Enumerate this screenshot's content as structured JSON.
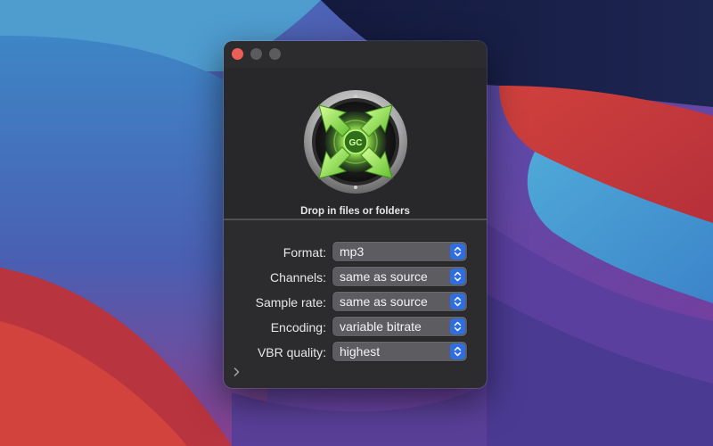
{
  "window": {
    "title": "",
    "traffic_lights": [
      "close",
      "minimize",
      "zoom"
    ]
  },
  "drop_zone": {
    "icon": "audio-converter-app-icon",
    "label": "Drop in files or folders"
  },
  "settings": {
    "format": {
      "label": "Format:",
      "value": "mp3"
    },
    "channels": {
      "label": "Channels:",
      "value": "same as source"
    },
    "sample_rate": {
      "label": "Sample rate:",
      "value": "same as source"
    },
    "encoding": {
      "label": "Encoding:",
      "value": "variable bitrate"
    },
    "vbr_quality": {
      "label": "VBR quality:",
      "value": "highest"
    }
  },
  "disclosure": {
    "icon": "chevron-right-icon"
  },
  "colors": {
    "window_bg": "#2c2c2e",
    "popup_bg": "#5c5c61",
    "stepper_accent": "#2e6ee0",
    "close_button": "#ec5f57",
    "logo_green": "#8fe048"
  }
}
